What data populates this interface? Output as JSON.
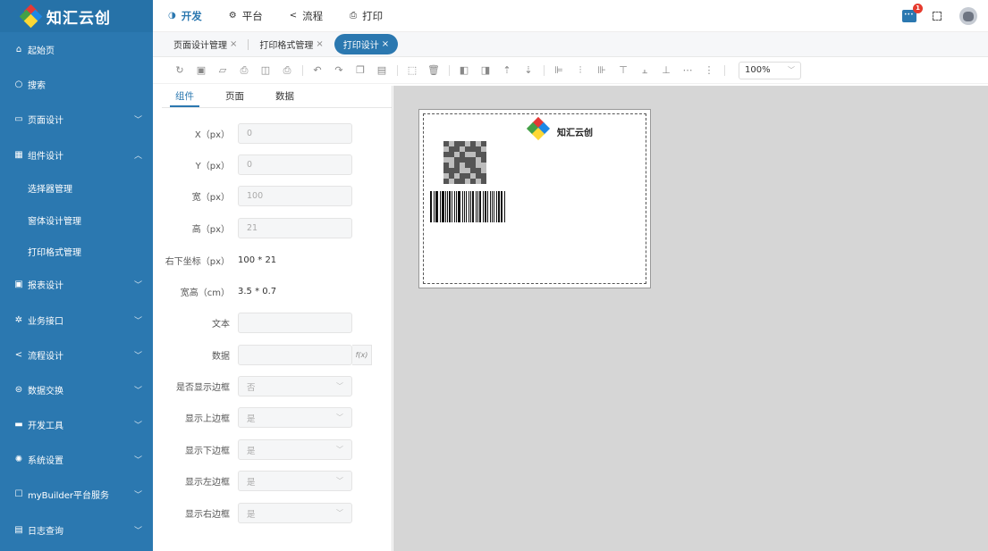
{
  "brand": {
    "name": "知汇云创"
  },
  "sidebar": {
    "items": [
      {
        "icon": "home-icon",
        "glyph": "⌂",
        "label": "起始页",
        "chevron": ""
      },
      {
        "icon": "search-icon",
        "glyph": "○",
        "label": "搜索",
        "chevron": ""
      },
      {
        "icon": "page-design-icon",
        "glyph": "▭",
        "label": "页面设计",
        "chevron": "﹀"
      },
      {
        "icon": "component-design-icon",
        "glyph": "▦",
        "label": "组件设计",
        "chevron": "︿"
      },
      {
        "icon": "report-design-icon",
        "glyph": "▣",
        "label": "报表设计",
        "chevron": "﹀"
      },
      {
        "icon": "business-api-icon",
        "glyph": "✲",
        "label": "业务接口",
        "chevron": "﹀"
      },
      {
        "icon": "workflow-design-icon",
        "glyph": "<",
        "label": "流程设计",
        "chevron": "﹀"
      },
      {
        "icon": "data-exchange-icon",
        "glyph": "⊜",
        "label": "数据交换",
        "chevron": "﹀"
      },
      {
        "icon": "dev-tools-icon",
        "glyph": "▬",
        "label": "开发工具",
        "chevron": "﹀"
      },
      {
        "icon": "system-settings-icon",
        "glyph": "✺",
        "label": "系统设置",
        "chevron": "﹀"
      },
      {
        "icon": "mybuilder-service-icon",
        "glyph": "☐",
        "label": "myBuilder平台服务",
        "chevron": "﹀"
      },
      {
        "icon": "log-query-icon",
        "glyph": "▤",
        "label": "日志查询",
        "chevron": "﹀"
      }
    ],
    "subitems": [
      {
        "label": "选择器管理"
      },
      {
        "label": "窗体设计管理"
      },
      {
        "label": "打印格式管理"
      }
    ]
  },
  "topnav": {
    "items": [
      {
        "glyph": "◑",
        "label": "开发"
      },
      {
        "glyph": "⚙",
        "label": "平台"
      },
      {
        "glyph": "<",
        "label": "流程"
      },
      {
        "glyph": "⎙",
        "label": "打印"
      }
    ],
    "badge": "1"
  },
  "tabs": [
    {
      "label": "页面设计管理"
    },
    {
      "label": "打印格式管理"
    },
    {
      "label": "打印设计"
    }
  ],
  "toolbar": {
    "zoom": "100%"
  },
  "panel": {
    "tabs": [
      "组件",
      "页面",
      "数据"
    ],
    "fields": {
      "x_label": "X（px）",
      "x_value": "0",
      "y_label": "Y（px）",
      "y_value": "0",
      "w_label": "宽（px）",
      "w_value": "100",
      "h_label": "高（px）",
      "h_value": "21",
      "br_label": "右下坐标（px）",
      "br_value": "100 * 21",
      "wh_label": "宽高（cm）",
      "wh_value": "3.5 * 0.7",
      "text_label": "文本",
      "text_value": "",
      "data_label": "数据",
      "data_value": "",
      "fx": "f(x)",
      "border_label": "是否显示边框",
      "border_value": "否",
      "top_label": "显示上边框",
      "top_value": "是",
      "bottom_label": "显示下边框",
      "bottom_value": "是",
      "left_label": "显示左边框",
      "left_value": "是",
      "right_label": "显示右边框",
      "right_value": "是"
    }
  },
  "paper": {
    "brand": "知汇云创"
  },
  "colors": {
    "primary": "#2b78b0",
    "sidebar": "#2b78b0",
    "canvas": "#d6d6d6",
    "badge": "#e63b2e"
  }
}
